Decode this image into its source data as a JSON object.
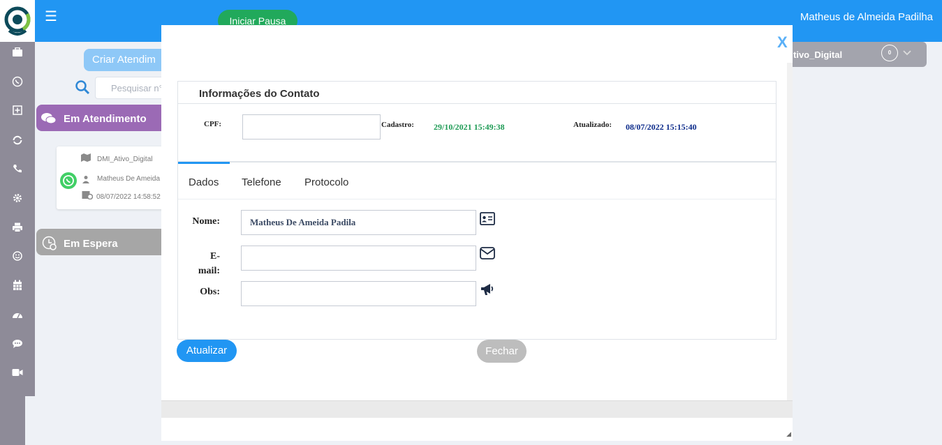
{
  "header": {
    "pause_button_label": "Iniciar Pausa",
    "user_name": "Matheus de Almeida Padilha",
    "menu_icon": "hamburger-icon"
  },
  "sidebar": {
    "icons": [
      "briefcase-icon",
      "whatsapp-icon",
      "plus-square-icon",
      "refresh-icon",
      "phone-icon",
      "gear-icon",
      "printer-icon",
      "smiley-icon",
      "calendar-icon",
      "dashboard-icon",
      "chat-icon",
      "video-icon"
    ]
  },
  "queue": {
    "create_button_label": "Criar Atendim",
    "search_placeholder": "Pesquisar n°",
    "in_service_label": "Em Atendimento",
    "waiting_label": "Em Espera",
    "card": {
      "channel": "DMI_Ativo_Digital",
      "agent": "Matheus De Ameida",
      "datetime": "08/07/2022 14:58:52"
    }
  },
  "agent_status": {
    "label": "tivo_Digital",
    "count": "0"
  },
  "modal": {
    "close_label": "X",
    "info_title": "Informações do Contato",
    "cpf_label": "CPF:",
    "cpf_value": "",
    "cadastro_label": "Cadastro:",
    "cadastro_value": "29/10/2021 15:49:38",
    "atualizado_label": "Atualizado:",
    "atualizado_value": "08/07/2022 15:15:40",
    "tabs": [
      "Dados",
      "Telefone",
      "Protocolo"
    ],
    "active_tab": "Dados",
    "fields": {
      "nome_label": "Nome:",
      "nome_value": "Matheus De Ameida Padila",
      "email_label_1": "E-",
      "email_label_2": "mail:",
      "email_value": "",
      "obs_label": "Obs:",
      "obs_value": ""
    },
    "update_button_label": "Atualizar",
    "close_button_label": "Fechar"
  },
  "colors": {
    "primary": "#2196f3",
    "pause_green": "#21a95b",
    "in_service_purple": "#9b6ab5",
    "waiting_gray": "#a6a6a6",
    "sidebar_gray": "#8e8b98",
    "cadastro_green": "#1e9b55",
    "atualizado_navy": "#0b2a8a"
  }
}
